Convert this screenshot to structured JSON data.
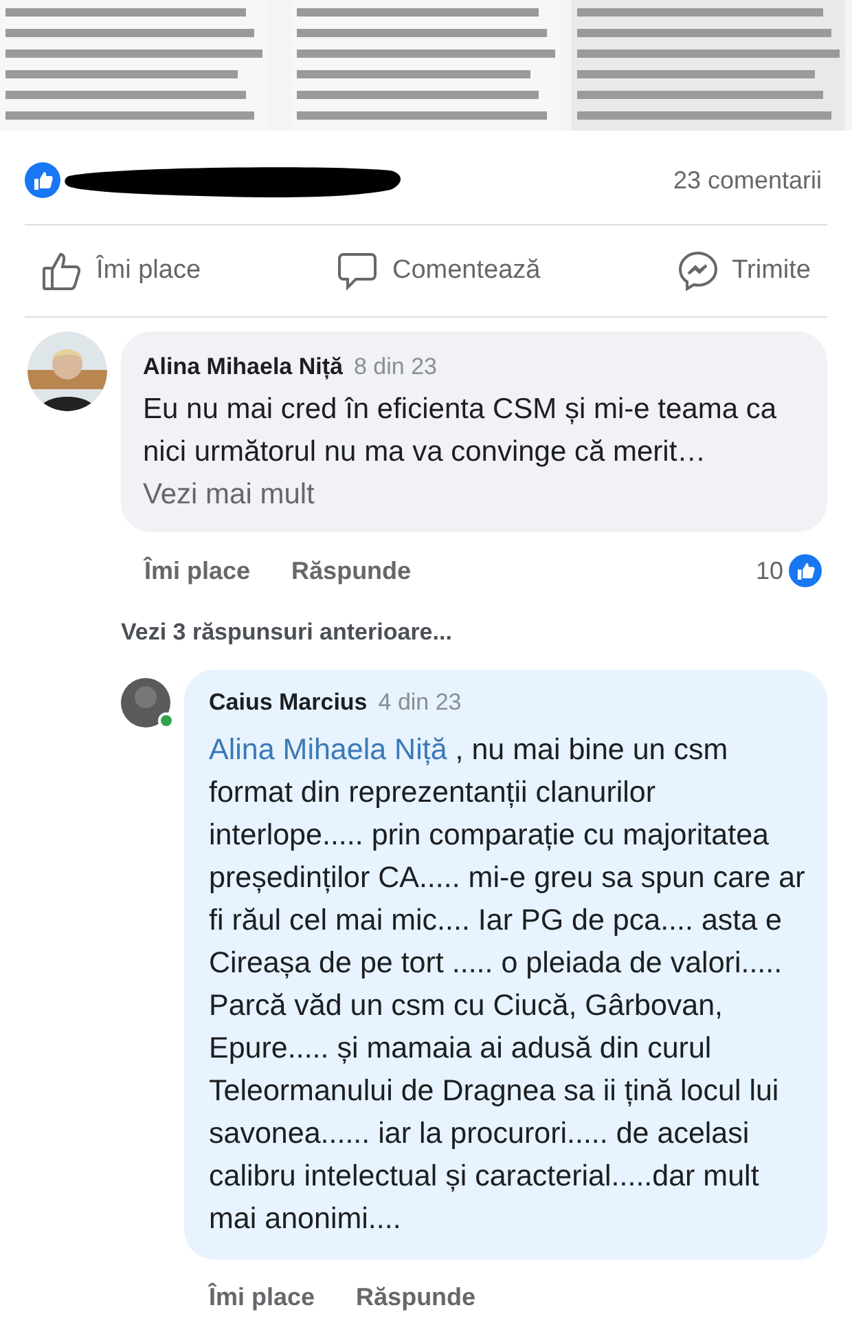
{
  "reactions": {
    "count_label": "23 comentarii"
  },
  "actions": [
    {
      "kind": "like",
      "label": "Îmi place"
    },
    {
      "kind": "comment",
      "label": "Comentează"
    },
    {
      "kind": "share",
      "label": "Trimite"
    }
  ],
  "comment": {
    "author": "Alina Mihaela Niță",
    "time": "8 din 23",
    "text": "Eu nu mai cred în eficienta CSM și mi-e teama ca nici următorul nu ma va convinge că merit…",
    "more": "Vezi mai mult",
    "like": "Îmi place",
    "reply": "Răspunde",
    "likes": "10"
  },
  "previous_replies": "Vezi 3 răspunsuri anterioare...",
  "reply": {
    "author": "Caius Marcius",
    "time": "4 din 23",
    "online": true,
    "mention": "Alina Mihaela Niță",
    "text": " , nu mai bine un csm format din reprezentanții clanurilor interlope..... prin comparație cu majoritatea președinților CA..... mi-e greu sa spun care ar fi răul cel mai mic....  Iar PG de pca.... asta e Cireașa de pe tort ..... o pleiada de valori..... Parcă văd un csm cu Ciucă, Gârbovan, Epure..... și mamaia ai adusă din curul Teleormanului de Dragnea sa ii țină locul lui savonea...... iar la procurori..... de acelasi calibru intelectual și caracterial.....dar mult mai anonimi....",
    "like": "Îmi place",
    "reply": "Răspunde"
  }
}
